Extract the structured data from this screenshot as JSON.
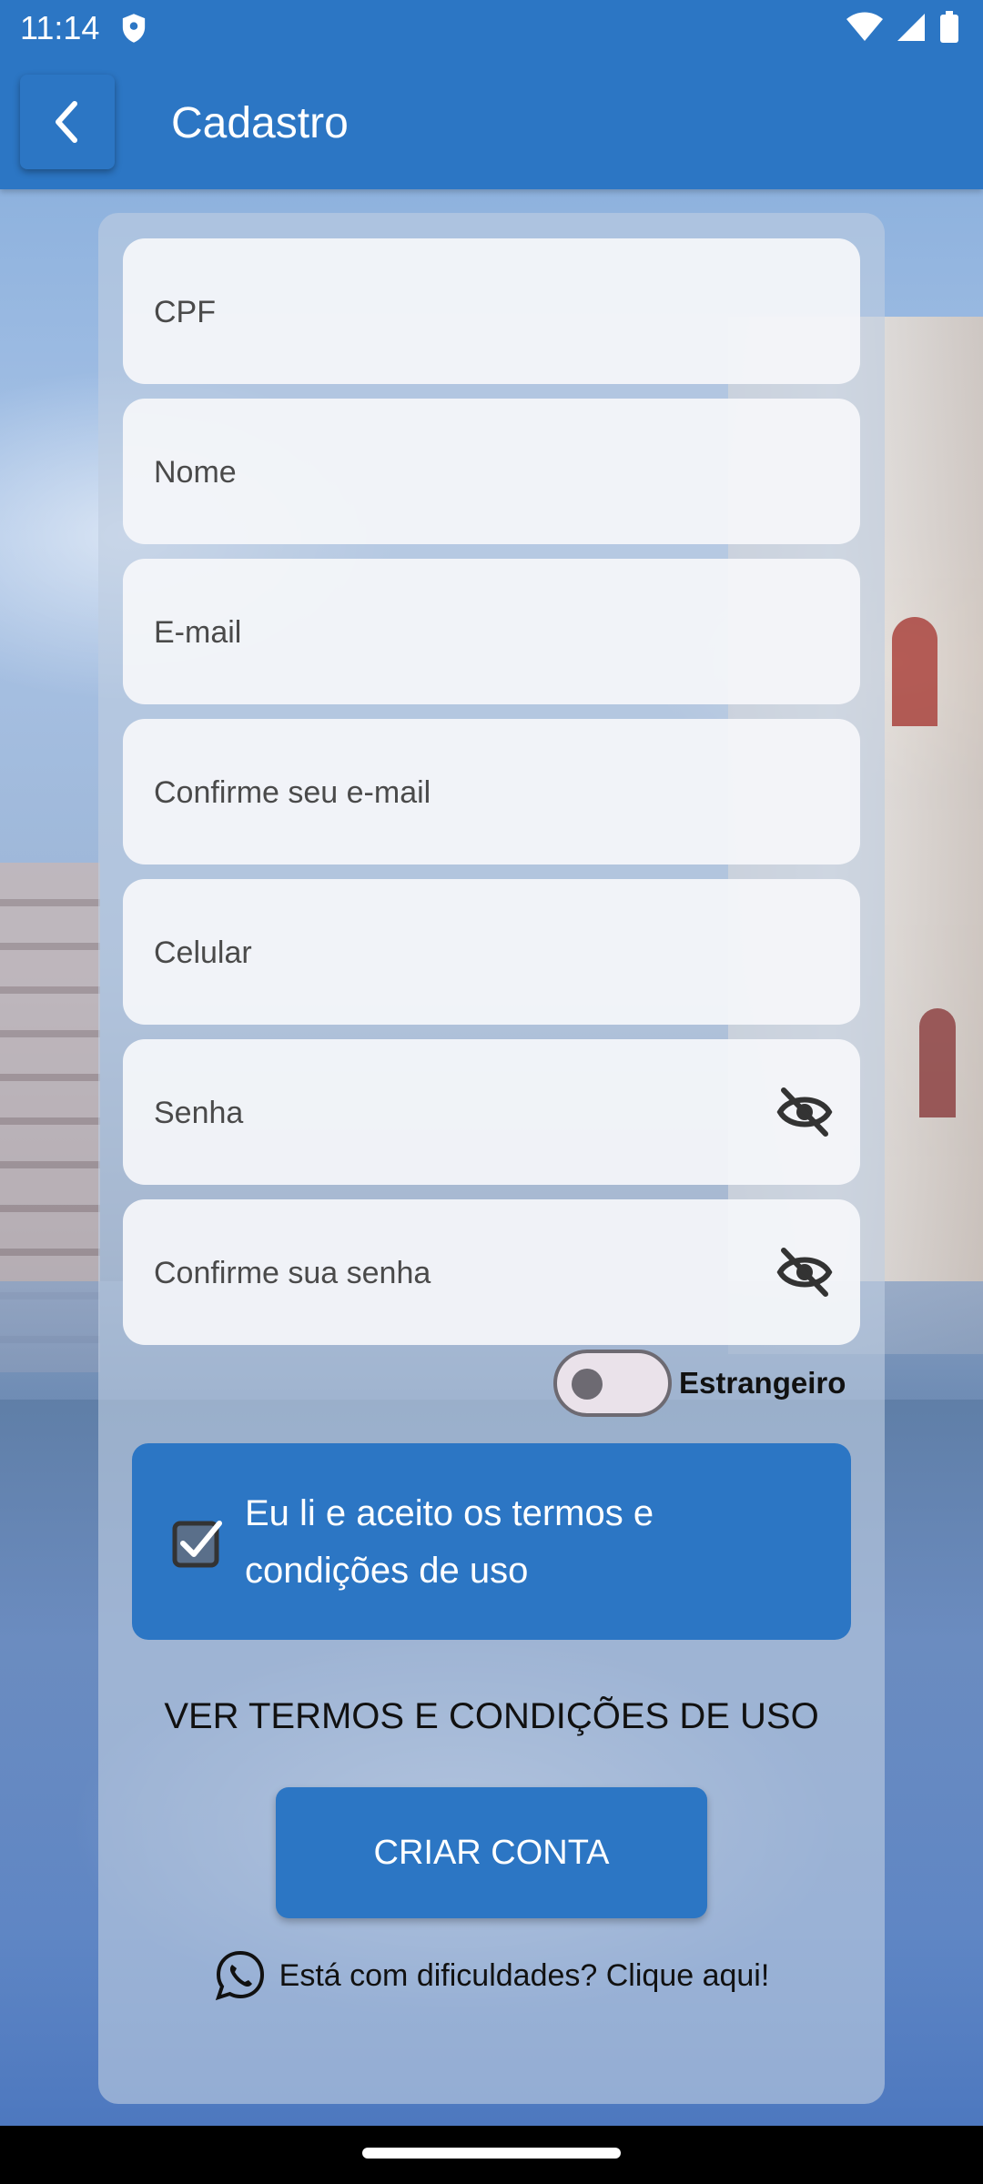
{
  "status_bar": {
    "time": "11:14"
  },
  "header": {
    "title": "Cadastro"
  },
  "form": {
    "fields": [
      {
        "placeholder": "CPF",
        "value": ""
      },
      {
        "placeholder": "Nome",
        "value": ""
      },
      {
        "placeholder": "E-mail",
        "value": ""
      },
      {
        "placeholder": "Confirme seu e-mail",
        "value": ""
      },
      {
        "placeholder": "Celular",
        "value": ""
      },
      {
        "placeholder": "Senha",
        "value": ""
      },
      {
        "placeholder": "Confirme sua senha",
        "value": ""
      }
    ],
    "foreign_toggle": {
      "label": "Estrangeiro",
      "checked": false
    },
    "terms": {
      "label": "Eu li e aceito os termos e condições de uso",
      "checked": true
    },
    "terms_link": "VER TERMOS E CONDIÇÕES DE USO",
    "submit_label": "CRIAR CONTA",
    "help_text": "Está com dificuldades? Clique aqui!"
  },
  "colors": {
    "primary": "#2c76c4",
    "card": "#bfcde1",
    "field": "#f5f6fa"
  },
  "icons": {
    "back": "arrow-back-icon",
    "password_visibility": "eye-off-icon",
    "whatsapp": "whatsapp-icon",
    "checkbox": "checkbox-checked-icon"
  }
}
